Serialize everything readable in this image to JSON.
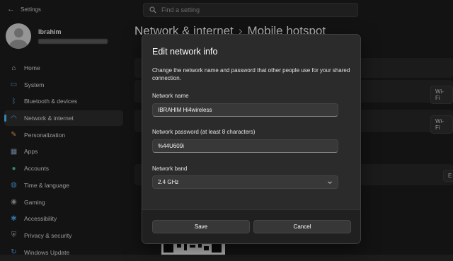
{
  "app": {
    "title": "Settings"
  },
  "search": {
    "placeholder": "Find a setting"
  },
  "profile": {
    "name": "Ibrahim"
  },
  "nav": [
    {
      "label": "Home",
      "icon": "home-icon",
      "color": "#d9d9d9",
      "active": false
    },
    {
      "label": "System",
      "icon": "system-icon",
      "color": "#4aa3e8",
      "active": false
    },
    {
      "label": "Bluetooth & devices",
      "icon": "bluetooth-icon",
      "color": "#4aa3e8",
      "active": false
    },
    {
      "label": "Network & internet",
      "icon": "wifi-icon",
      "color": "#4cc2ff",
      "active": true
    },
    {
      "label": "Personalization",
      "icon": "brush-icon",
      "color": "#e8a25a",
      "active": false
    },
    {
      "label": "Apps",
      "icon": "apps-icon",
      "color": "#9ab6d6",
      "active": false
    },
    {
      "label": "Accounts",
      "icon": "accounts-icon",
      "color": "#4bc08a",
      "active": false
    },
    {
      "label": "Time & language",
      "icon": "globe-icon",
      "color": "#4aa3e8",
      "active": false
    },
    {
      "label": "Gaming",
      "icon": "gaming-icon",
      "color": "#a7a7a7",
      "active": false
    },
    {
      "label": "Accessibility",
      "icon": "accessibility-icon",
      "color": "#4aa3e8",
      "active": false
    },
    {
      "label": "Privacy & security",
      "icon": "shield-icon",
      "color": "#a7a7a7",
      "active": false
    },
    {
      "label": "Windows Update",
      "icon": "update-icon",
      "color": "#4aa3e8",
      "active": false
    }
  ],
  "page": {
    "breadcrumb_parent": "Network & internet",
    "breadcrumb_separator": "›",
    "title": "Mobile hotspot"
  },
  "background_buttons": {
    "wifi_1": "Wi-Fi",
    "wifi_2": "Wi-Fi",
    "edit": "E"
  },
  "dialog": {
    "title": "Edit network info",
    "description": "Change the network name and password that other people use for your shared connection.",
    "name_label": "Network name",
    "name_value": "IBRAHIM Hi4wireless",
    "password_label": "Network password (at least 8 characters)",
    "password_value": "%44U609i",
    "band_label": "Network band",
    "band_value": "2.4 GHz",
    "save_label": "Save",
    "cancel_label": "Cancel"
  }
}
